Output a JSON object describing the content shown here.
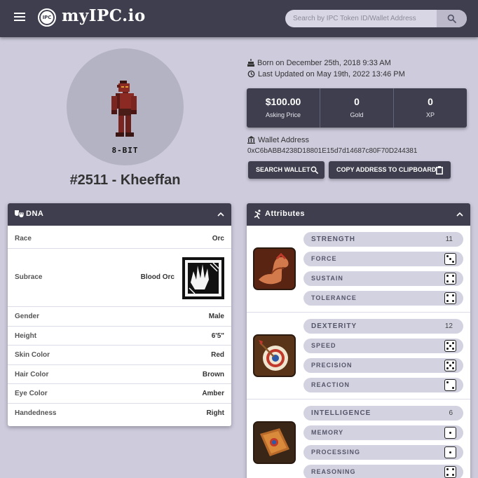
{
  "header": {
    "logo_badge": "IPC",
    "logo_text": "myIPC.io",
    "search_placeholder": "Search by IPC Token ID/Wallet Address"
  },
  "character": {
    "avatar_tag": "8-BIT",
    "name": "#2511 - Kheeffan",
    "born": "Born on December 25th, 2018 9:33 AM",
    "updated": "Last Updated on May 19th, 2022 13:46 PM"
  },
  "stats": [
    {
      "value": "$100.00",
      "label": "Asking Price"
    },
    {
      "value": "0",
      "label": "Gold"
    },
    {
      "value": "0",
      "label": "XP"
    }
  ],
  "wallet": {
    "label": "Wallet Address",
    "address": "0xC6bABB4238D18801E15d7d14687c80F70D244381",
    "search_button": "SEARCH WALLET",
    "copy_button": "COPY ADDRESS TO CLIPBOARD"
  },
  "dna": {
    "title": "DNA",
    "rows": [
      {
        "key": "Race",
        "value": "Orc"
      },
      {
        "key": "Subrace",
        "value": "Blood Orc"
      },
      {
        "key": "Gender",
        "value": "Male"
      },
      {
        "key": "Height",
        "value": "6'5\""
      },
      {
        "key": "Skin Color",
        "value": "Red"
      },
      {
        "key": "Hair Color",
        "value": "Brown"
      },
      {
        "key": "Eye Color",
        "value": "Amber"
      },
      {
        "key": "Handedness",
        "value": "Right"
      }
    ]
  },
  "attributes": {
    "title": "Attributes",
    "groups": [
      {
        "name": "STRENGTH",
        "value": "11",
        "icon": "flexed-arm-icon",
        "subs": [
          {
            "name": "FORCE",
            "die": 3
          },
          {
            "name": "SUSTAIN",
            "die": 4
          },
          {
            "name": "TOLERANCE",
            "die": 4
          }
        ]
      },
      {
        "name": "DEXTERITY",
        "value": "12",
        "icon": "archery-target-icon",
        "subs": [
          {
            "name": "SPEED",
            "die": 5
          },
          {
            "name": "PRECISION",
            "die": 5
          },
          {
            "name": "REACTION",
            "die": 2
          }
        ]
      },
      {
        "name": "INTELLIGENCE",
        "value": "6",
        "icon": "spellbook-icon",
        "subs": [
          {
            "name": "MEMORY",
            "die": 1
          },
          {
            "name": "PROCESSING",
            "die": 1
          },
          {
            "name": "REASONING",
            "die": 4
          }
        ]
      }
    ]
  }
}
